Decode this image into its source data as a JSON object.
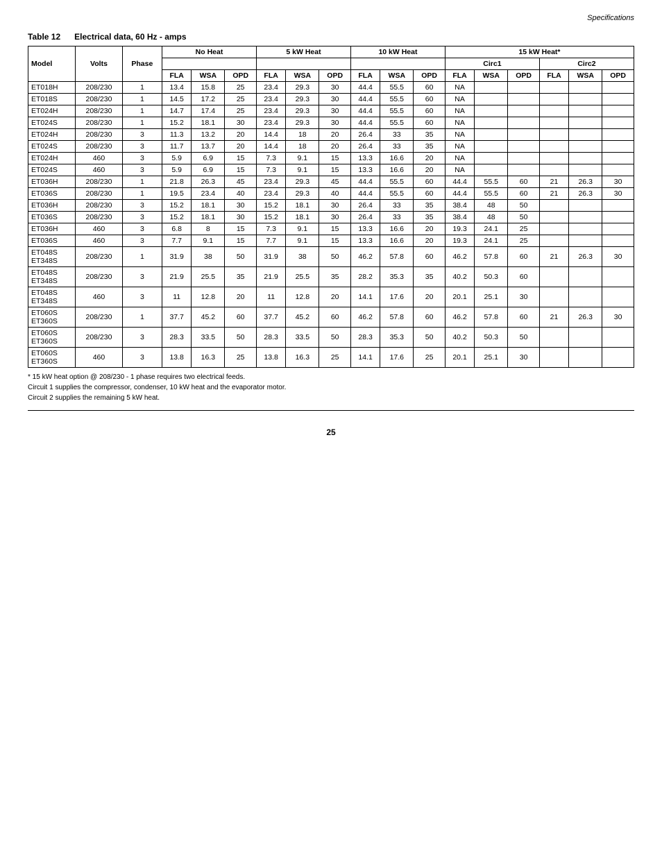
{
  "page": {
    "header": "Specifications",
    "footer_page": "25",
    "table_title": "Table 12",
    "table_subtitle": "Electrical data, 60 Hz - amps"
  },
  "column_groups": [
    {
      "label": "",
      "colspan": 3
    },
    {
      "label": "No Heat",
      "colspan": 3
    },
    {
      "label": "5 kW Heat",
      "colspan": 3
    },
    {
      "label": "10 kW Heat",
      "colspan": 3
    },
    {
      "label": "15 kW Heat*",
      "colspan": 6
    }
  ],
  "sub_groups": [
    {
      "label": "Circ1",
      "colspan": 3
    },
    {
      "label": "Circ2",
      "colspan": 3
    }
  ],
  "col_headers": [
    "Model",
    "Volts",
    "Phase",
    "FLA",
    "WSA",
    "OPD",
    "FLA",
    "WSA",
    "OPD",
    "FLA",
    "WSA",
    "OPD",
    "FLA",
    "WSA",
    "OPD",
    "FLA",
    "WSA",
    "OPD"
  ],
  "rows": [
    {
      "model": "ET018H",
      "volts": "208/230",
      "phase": "1",
      "nh_fla": "13.4",
      "nh_wsa": "15.8",
      "nh_opd": "25",
      "h5_fla": "23.4",
      "h5_wsa": "29.3",
      "h5_opd": "30",
      "h10_fla": "44.4",
      "h10_wsa": "55.5",
      "h10_opd": "60",
      "c1_fla": "NA",
      "c1_wsa": "",
      "c1_opd": "",
      "c2_fla": "",
      "c2_wsa": "",
      "c2_opd": ""
    },
    {
      "model": "ET018S",
      "volts": "208/230",
      "phase": "1",
      "nh_fla": "14.5",
      "nh_wsa": "17.2",
      "nh_opd": "25",
      "h5_fla": "23.4",
      "h5_wsa": "29.3",
      "h5_opd": "30",
      "h10_fla": "44.4",
      "h10_wsa": "55.5",
      "h10_opd": "60",
      "c1_fla": "NA",
      "c1_wsa": "",
      "c1_opd": "",
      "c2_fla": "",
      "c2_wsa": "",
      "c2_opd": ""
    },
    {
      "model": "ET024H",
      "volts": "208/230",
      "phase": "1",
      "nh_fla": "14.7",
      "nh_wsa": "17.4",
      "nh_opd": "25",
      "h5_fla": "23.4",
      "h5_wsa": "29.3",
      "h5_opd": "30",
      "h10_fla": "44.4",
      "h10_wsa": "55.5",
      "h10_opd": "60",
      "c1_fla": "NA",
      "c1_wsa": "",
      "c1_opd": "",
      "c2_fla": "",
      "c2_wsa": "",
      "c2_opd": ""
    },
    {
      "model": "ET024S",
      "volts": "208/230",
      "phase": "1",
      "nh_fla": "15.2",
      "nh_wsa": "18.1",
      "nh_opd": "30",
      "h5_fla": "23.4",
      "h5_wsa": "29.3",
      "h5_opd": "30",
      "h10_fla": "44.4",
      "h10_wsa": "55.5",
      "h10_opd": "60",
      "c1_fla": "NA",
      "c1_wsa": "",
      "c1_opd": "",
      "c2_fla": "",
      "c2_wsa": "",
      "c2_opd": ""
    },
    {
      "model": "ET024H",
      "volts": "208/230",
      "phase": "3",
      "nh_fla": "11.3",
      "nh_wsa": "13.2",
      "nh_opd": "20",
      "h5_fla": "14.4",
      "h5_wsa": "18",
      "h5_opd": "20",
      "h10_fla": "26.4",
      "h10_wsa": "33",
      "h10_opd": "35",
      "c1_fla": "NA",
      "c1_wsa": "",
      "c1_opd": "",
      "c2_fla": "",
      "c2_wsa": "",
      "c2_opd": ""
    },
    {
      "model": "ET024S",
      "volts": "208/230",
      "phase": "3",
      "nh_fla": "11.7",
      "nh_wsa": "13.7",
      "nh_opd": "20",
      "h5_fla": "14.4",
      "h5_wsa": "18",
      "h5_opd": "20",
      "h10_fla": "26.4",
      "h10_wsa": "33",
      "h10_opd": "35",
      "c1_fla": "NA",
      "c1_wsa": "",
      "c1_opd": "",
      "c2_fla": "",
      "c2_wsa": "",
      "c2_opd": ""
    },
    {
      "model": "ET024H",
      "volts": "460",
      "phase": "3",
      "nh_fla": "5.9",
      "nh_wsa": "6.9",
      "nh_opd": "15",
      "h5_fla": "7.3",
      "h5_wsa": "9.1",
      "h5_opd": "15",
      "h10_fla": "13.3",
      "h10_wsa": "16.6",
      "h10_opd": "20",
      "c1_fla": "NA",
      "c1_wsa": "",
      "c1_opd": "",
      "c2_fla": "",
      "c2_wsa": "",
      "c2_opd": ""
    },
    {
      "model": "ET024S",
      "volts": "460",
      "phase": "3",
      "nh_fla": "5.9",
      "nh_wsa": "6.9",
      "nh_opd": "15",
      "h5_fla": "7.3",
      "h5_wsa": "9.1",
      "h5_opd": "15",
      "h10_fla": "13.3",
      "h10_wsa": "16.6",
      "h10_opd": "20",
      "c1_fla": "NA",
      "c1_wsa": "",
      "c1_opd": "",
      "c2_fla": "",
      "c2_wsa": "",
      "c2_opd": ""
    },
    {
      "model": "ET036H",
      "volts": "208/230",
      "phase": "1",
      "nh_fla": "21.8",
      "nh_wsa": "26.3",
      "nh_opd": "45",
      "h5_fla": "23.4",
      "h5_wsa": "29.3",
      "h5_opd": "45",
      "h10_fla": "44.4",
      "h10_wsa": "55.5",
      "h10_opd": "60",
      "c1_fla": "44.4",
      "c1_wsa": "55.5",
      "c1_opd": "60",
      "c2_fla": "21",
      "c2_wsa": "26.3",
      "c2_opd": "30"
    },
    {
      "model": "ET036S",
      "volts": "208/230",
      "phase": "1",
      "nh_fla": "19.5",
      "nh_wsa": "23.4",
      "nh_opd": "40",
      "h5_fla": "23.4",
      "h5_wsa": "29.3",
      "h5_opd": "40",
      "h10_fla": "44.4",
      "h10_wsa": "55.5",
      "h10_opd": "60",
      "c1_fla": "44.4",
      "c1_wsa": "55.5",
      "c1_opd": "60",
      "c2_fla": "21",
      "c2_wsa": "26.3",
      "c2_opd": "30"
    },
    {
      "model": "ET036H",
      "volts": "208/230",
      "phase": "3",
      "nh_fla": "15.2",
      "nh_wsa": "18.1",
      "nh_opd": "30",
      "h5_fla": "15.2",
      "h5_wsa": "18.1",
      "h5_opd": "30",
      "h10_fla": "26.4",
      "h10_wsa": "33",
      "h10_opd": "35",
      "c1_fla": "38.4",
      "c1_wsa": "48",
      "c1_opd": "50",
      "c2_fla": "",
      "c2_wsa": "",
      "c2_opd": ""
    },
    {
      "model": "ET036S",
      "volts": "208/230",
      "phase": "3",
      "nh_fla": "15.2",
      "nh_wsa": "18.1",
      "nh_opd": "30",
      "h5_fla": "15.2",
      "h5_wsa": "18.1",
      "h5_opd": "30",
      "h10_fla": "26.4",
      "h10_wsa": "33",
      "h10_opd": "35",
      "c1_fla": "38.4",
      "c1_wsa": "48",
      "c1_opd": "50",
      "c2_fla": "",
      "c2_wsa": "",
      "c2_opd": ""
    },
    {
      "model": "ET036H",
      "volts": "460",
      "phase": "3",
      "nh_fla": "6.8",
      "nh_wsa": "8",
      "nh_opd": "15",
      "h5_fla": "7.3",
      "h5_wsa": "9.1",
      "h5_opd": "15",
      "h10_fla": "13.3",
      "h10_wsa": "16.6",
      "h10_opd": "20",
      "c1_fla": "19.3",
      "c1_wsa": "24.1",
      "c1_opd": "25",
      "c2_fla": "",
      "c2_wsa": "",
      "c2_opd": ""
    },
    {
      "model": "ET036S",
      "volts": "460",
      "phase": "3",
      "nh_fla": "7.7",
      "nh_wsa": "9.1",
      "nh_opd": "15",
      "h5_fla": "7.7",
      "h5_wsa": "9.1",
      "h5_opd": "15",
      "h10_fla": "13.3",
      "h10_wsa": "16.6",
      "h10_opd": "20",
      "c1_fla": "19.3",
      "c1_wsa": "24.1",
      "c1_opd": "25",
      "c2_fla": "",
      "c2_wsa": "",
      "c2_opd": ""
    },
    {
      "model": "ET048S\nET348S",
      "volts": "208/230",
      "phase": "1",
      "nh_fla": "31.9",
      "nh_wsa": "38",
      "nh_opd": "50",
      "h5_fla": "31.9",
      "h5_wsa": "38",
      "h5_opd": "50",
      "h10_fla": "46.2",
      "h10_wsa": "57.8",
      "h10_opd": "60",
      "c1_fla": "46.2",
      "c1_wsa": "57.8",
      "c1_opd": "60",
      "c2_fla": "21",
      "c2_wsa": "26.3",
      "c2_opd": "30"
    },
    {
      "model": "ET048S\nET348S",
      "volts": "208/230",
      "phase": "3",
      "nh_fla": "21.9",
      "nh_wsa": "25.5",
      "nh_opd": "35",
      "h5_fla": "21.9",
      "h5_wsa": "25.5",
      "h5_opd": "35",
      "h10_fla": "28.2",
      "h10_wsa": "35.3",
      "h10_opd": "35",
      "c1_fla": "40.2",
      "c1_wsa": "50.3",
      "c1_opd": "60",
      "c2_fla": "",
      "c2_wsa": "",
      "c2_opd": ""
    },
    {
      "model": "ET048S\nET348S",
      "volts": "460",
      "phase": "3",
      "nh_fla": "11",
      "nh_wsa": "12.8",
      "nh_opd": "20",
      "h5_fla": "11",
      "h5_wsa": "12.8",
      "h5_opd": "20",
      "h10_fla": "14.1",
      "h10_wsa": "17.6",
      "h10_opd": "20",
      "c1_fla": "20.1",
      "c1_wsa": "25.1",
      "c1_opd": "30",
      "c2_fla": "",
      "c2_wsa": "",
      "c2_opd": ""
    },
    {
      "model": "ET060S\nET360S",
      "volts": "208/230",
      "phase": "1",
      "nh_fla": "37.7",
      "nh_wsa": "45.2",
      "nh_opd": "60",
      "h5_fla": "37.7",
      "h5_wsa": "45.2",
      "h5_opd": "60",
      "h10_fla": "46.2",
      "h10_wsa": "57.8",
      "h10_opd": "60",
      "c1_fla": "46.2",
      "c1_wsa": "57.8",
      "c1_opd": "60",
      "c2_fla": "21",
      "c2_wsa": "26.3",
      "c2_opd": "30"
    },
    {
      "model": "ET060S\nET360S",
      "volts": "208/230",
      "phase": "3",
      "nh_fla": "28.3",
      "nh_wsa": "33.5",
      "nh_opd": "50",
      "h5_fla": "28.3",
      "h5_wsa": "33.5",
      "h5_opd": "50",
      "h10_fla": "28.3",
      "h10_wsa": "35.3",
      "h10_opd": "50",
      "c1_fla": "40.2",
      "c1_wsa": "50.3",
      "c1_opd": "50",
      "c2_fla": "",
      "c2_wsa": "",
      "c2_opd": ""
    },
    {
      "model": "ET060S\nET360S",
      "volts": "460",
      "phase": "3",
      "nh_fla": "13.8",
      "nh_wsa": "16.3",
      "nh_opd": "25",
      "h5_fla": "13.8",
      "h5_wsa": "16.3",
      "h5_opd": "25",
      "h10_fla": "14.1",
      "h10_wsa": "17.6",
      "h10_opd": "25",
      "c1_fla": "20.1",
      "c1_wsa": "25.1",
      "c1_opd": "30",
      "c2_fla": "",
      "c2_wsa": "",
      "c2_opd": ""
    }
  ],
  "notes": [
    "* 15 kW heat option @ 208/230 - 1 phase requires two electrical feeds.",
    "Circuit 1 supplies the compressor, condenser, 10 kW heat and the evaporator motor.",
    "Circuit 2 supplies the remaining 5 kW heat."
  ]
}
